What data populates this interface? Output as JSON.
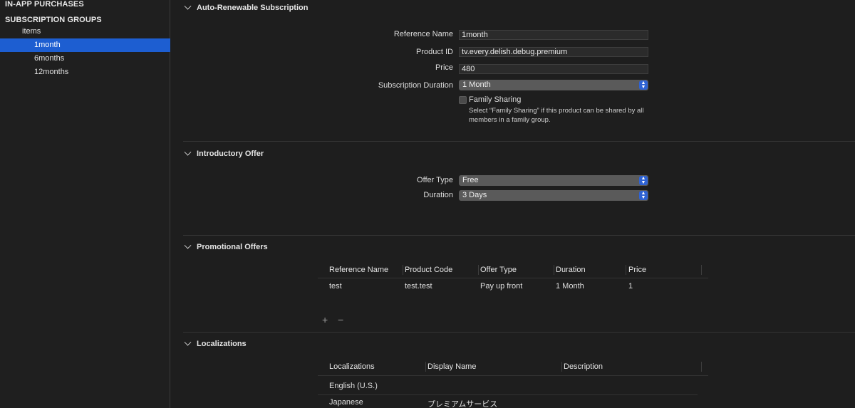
{
  "sidebar": {
    "in_app_purchases": "IN-APP PURCHASES",
    "subscription_groups": "SUBSCRIPTION GROUPS",
    "group_name": "items",
    "items": [
      "1month",
      "6months",
      "12months"
    ]
  },
  "auto_renewable": {
    "title": "Auto-Renewable Subscription",
    "reference_name_label": "Reference Name",
    "reference_name_value": "1month",
    "product_id_label": "Product ID",
    "product_id_value": "tv.every.delish.debug.premium",
    "price_label": "Price",
    "price_value": "480",
    "duration_label": "Subscription Duration",
    "duration_value": "1 Month",
    "family_sharing_label": "Family Sharing",
    "family_sharing_checked": false,
    "family_sharing_help": "Select “Family Sharing” if this product can be shared by all members in a family group."
  },
  "introductory": {
    "title": "Introductory Offer",
    "offer_type_label": "Offer Type",
    "offer_type_value": "Free",
    "duration_label": "Duration",
    "duration_value": "3 Days"
  },
  "promotional": {
    "title": "Promotional Offers",
    "columns": [
      "Reference Name",
      "Product Code",
      "Offer Type",
      "Duration",
      "Price"
    ],
    "rows": [
      [
        "test",
        "test.test",
        "Pay up front",
        "1 Month",
        "1"
      ]
    ],
    "add_symbol": "+",
    "remove_symbol": "−"
  },
  "localizations": {
    "title": "Localizations",
    "columns": [
      "Localizations",
      "Display Name",
      "Description"
    ],
    "rows": [
      [
        "English (U.S.)",
        "",
        ""
      ],
      [
        "Japanese",
        "プレミアムサービス",
        ""
      ]
    ]
  },
  "colors": {
    "selection": "#1d5ed1",
    "stepper": "#2f63d4",
    "background": "#1e1e1e"
  }
}
